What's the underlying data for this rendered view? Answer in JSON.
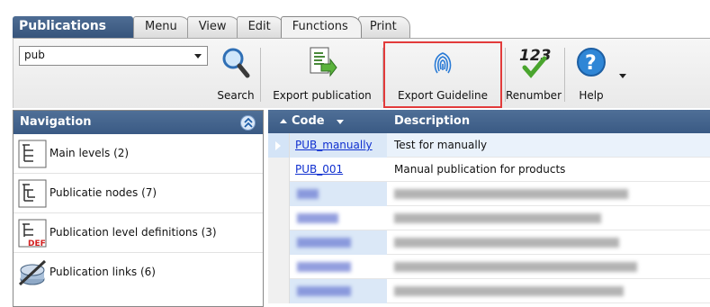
{
  "app": {
    "title": "Publications"
  },
  "tabs": [
    {
      "label": "Menu"
    },
    {
      "label": "View"
    },
    {
      "label": "Edit"
    },
    {
      "label": "Functions",
      "active": true
    },
    {
      "label": "Print"
    }
  ],
  "ribbon": {
    "search_value": "pub",
    "buttons": {
      "search": "Search",
      "export_publication": "Export publication",
      "export_guideline": "Export Guideline",
      "renumber": "Renumber",
      "help": "Help"
    },
    "renumber_icon_text": "123"
  },
  "navigation": {
    "title": "Navigation",
    "items": [
      {
        "label": "Main levels (2)",
        "icon": "tree-levels-icon"
      },
      {
        "label": "Publicatie nodes (7)",
        "icon": "tree-nodes-icon"
      },
      {
        "label": "Publication level definitions (3)",
        "icon": "tree-def-icon",
        "badge": "DEF"
      },
      {
        "label": "Publication links (6)",
        "icon": "links-icon"
      }
    ]
  },
  "grid": {
    "columns": {
      "code": "Code",
      "description": "Description"
    },
    "rows": [
      {
        "code": "PUB_manually",
        "description": "Test for manually",
        "selected": true
      },
      {
        "code": "PUB_001",
        "description": "Manual publication for products"
      },
      {
        "code": "",
        "description": ""
      },
      {
        "code": "",
        "description": ""
      },
      {
        "code": "",
        "description": ""
      },
      {
        "code": "",
        "description": ""
      },
      {
        "code": "",
        "description": ""
      }
    ]
  },
  "colors": {
    "header_blue": "#3f5f89",
    "highlight_red": "#e23b3b",
    "link_blue": "#1030d0"
  }
}
